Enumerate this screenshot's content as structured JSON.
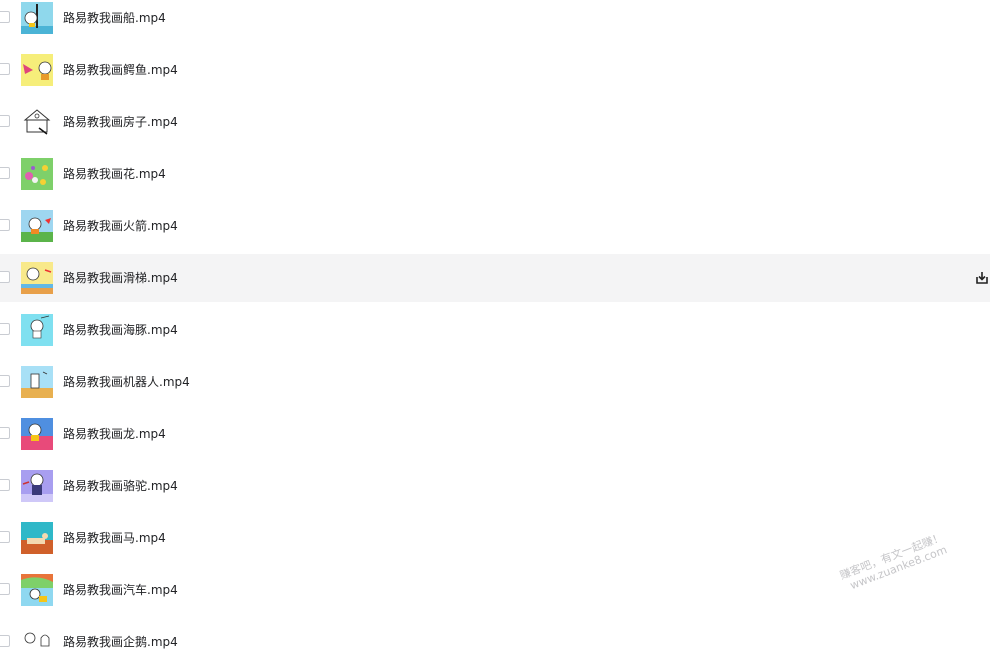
{
  "files": [
    {
      "name": "路易教我画船.mp4",
      "thumb": "boat"
    },
    {
      "name": "路易教我画鳄鱼.mp4",
      "thumb": "crocodile"
    },
    {
      "name": "路易教我画房子.mp4",
      "thumb": "house"
    },
    {
      "name": "路易教我画花.mp4",
      "thumb": "flower"
    },
    {
      "name": "路易教我画火箭.mp4",
      "thumb": "rocket"
    },
    {
      "name": "路易教我画滑梯.mp4",
      "thumb": "slide"
    },
    {
      "name": "路易教我画海豚.mp4",
      "thumb": "dolphin"
    },
    {
      "name": "路易教我画机器人.mp4",
      "thumb": "robot"
    },
    {
      "name": "路易教我画龙.mp4",
      "thumb": "dragon"
    },
    {
      "name": "路易教我画骆驼.mp4",
      "thumb": "camel"
    },
    {
      "name": "路易教我画马.mp4",
      "thumb": "horse"
    },
    {
      "name": "路易教我画汽车.mp4",
      "thumb": "car"
    },
    {
      "name": "路易教我画企鹅.mp4",
      "thumb": "penguin"
    }
  ],
  "hovered_index": 5,
  "hover_action_icon": "download-icon",
  "watermark": {
    "line1": "赚客吧，有文一起赚！",
    "line2": "www.zuanke8.com"
  },
  "colors": {
    "row_hover_bg": "#f4f4f5",
    "text": "#222326"
  }
}
